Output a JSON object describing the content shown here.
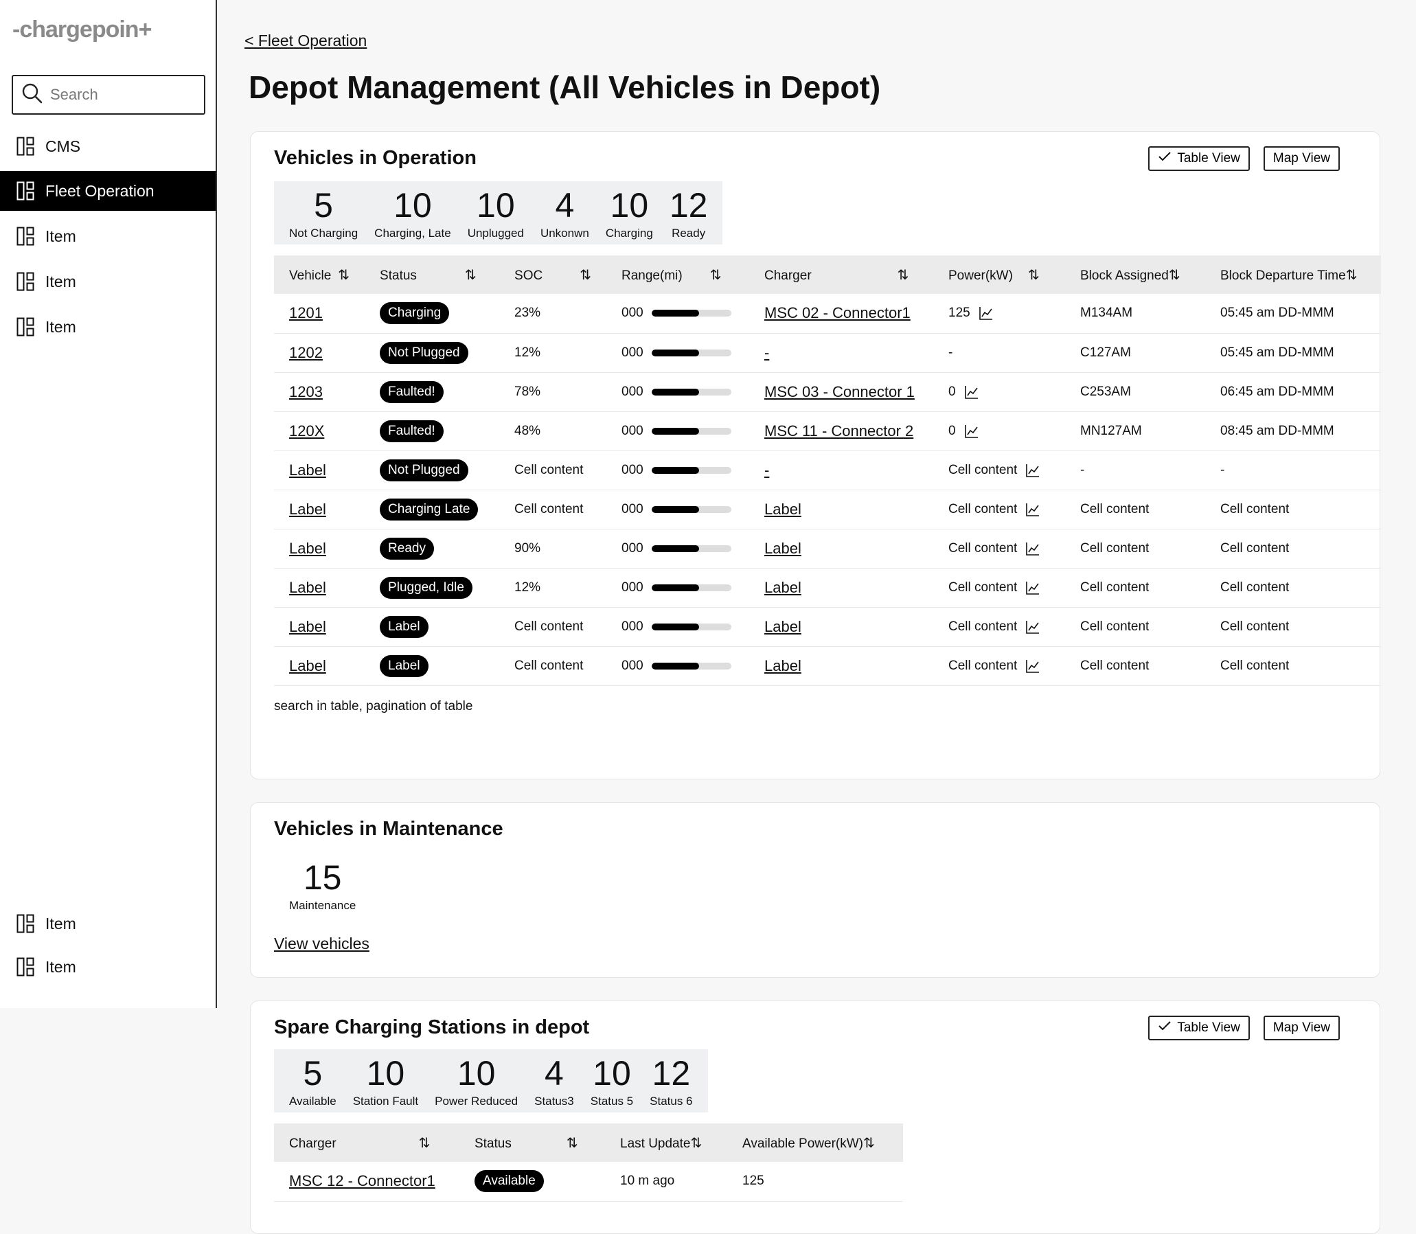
{
  "app": {
    "logo": "-chargepoin+"
  },
  "sidebar": {
    "search_placeholder": "Search",
    "items": [
      {
        "label": "CMS"
      },
      {
        "label": "Fleet Operation"
      },
      {
        "label": "Item"
      },
      {
        "label": "Item"
      },
      {
        "label": "Item"
      }
    ],
    "bottom_items": [
      {
        "label": "Item"
      },
      {
        "label": "Item"
      }
    ]
  },
  "breadcrumb": "< Fleet Operation",
  "page_title": "Depot Management (All Vehicles in Depot)",
  "operation": {
    "title": "Vehicles in Operation",
    "table_view": "Table View",
    "map_view": "Map View",
    "stats": [
      {
        "num": "5",
        "label": "Not Charging"
      },
      {
        "num": "10",
        "label": "Charging, Late"
      },
      {
        "num": "10",
        "label": "Unplugged"
      },
      {
        "num": "4",
        "label": "Unkonwn"
      },
      {
        "num": "10",
        "label": "Charging"
      },
      {
        "num": "12",
        "label": "Ready"
      }
    ],
    "columns": [
      "Vehicle",
      "Status",
      "SOC",
      "Range(mi)",
      "Charger",
      "Power(kW)",
      "Block Assigned",
      "Block Departure Time"
    ],
    "rows": [
      {
        "vehicle": "1201",
        "status": "Charging",
        "soc": "23%",
        "range": "000",
        "range_pct": 0.6,
        "charger": "MSC 02 - Connector1",
        "power": "125",
        "block": "M134AM",
        "departure": "05:45 am DD-MMM"
      },
      {
        "vehicle": "1202",
        "status": "Not Plugged",
        "soc": "12%",
        "range": "000",
        "range_pct": 0.6,
        "charger": "-",
        "power": "-",
        "block": "C127AM",
        "departure": "05:45 am DD-MMM"
      },
      {
        "vehicle": "1203",
        "status": "Faulted!",
        "soc": "78%",
        "range": "000",
        "range_pct": 0.6,
        "charger": "MSC 03 - Connector 1",
        "power": "0",
        "block": "C253AM",
        "departure": "06:45 am DD-MMM"
      },
      {
        "vehicle": "120X",
        "status": "Faulted!",
        "soc": "48%",
        "range": "000",
        "range_pct": 0.6,
        "charger": "MSC 11 - Connector 2",
        "power": "0",
        "block": "MN127AM",
        "departure": "08:45 am DD-MMM"
      },
      {
        "vehicle": "Label",
        "status": "Not Plugged",
        "soc": "Cell content",
        "range": "000",
        "range_pct": 0.6,
        "charger": "-",
        "power": "Cell content",
        "block": "-",
        "departure": "-"
      },
      {
        "vehicle": "Label",
        "status": "Charging Late",
        "soc": "Cell content",
        "range": "000",
        "range_pct": 0.6,
        "charger": "Label",
        "power": "Cell content",
        "block": "Cell content",
        "departure": "Cell content"
      },
      {
        "vehicle": "Label",
        "status": "Ready",
        "soc": "90%",
        "range": "000",
        "range_pct": 0.6,
        "charger": "Label",
        "power": "Cell content",
        "block": "Cell content",
        "departure": "Cell content"
      },
      {
        "vehicle": "Label",
        "status": "Plugged, Idle",
        "soc": "12%",
        "range": "000",
        "range_pct": 0.6,
        "charger": "Label",
        "power": "Cell content",
        "block": "Cell content",
        "departure": "Cell content"
      },
      {
        "vehicle": "Label",
        "status": "Label",
        "soc": "Cell content",
        "range": "000",
        "range_pct": 0.6,
        "charger": "Label",
        "power": "Cell content",
        "block": "Cell content",
        "departure": "Cell content"
      },
      {
        "vehicle": "Label",
        "status": "Label",
        "soc": "Cell content",
        "range": "000",
        "range_pct": 0.6,
        "charger": "Label",
        "power": "Cell content",
        "block": "Cell content",
        "departure": "Cell content"
      }
    ],
    "note": "search in table, pagination of table"
  },
  "maintenance": {
    "title": "Vehicles in Maintenance",
    "stats": [
      {
        "num": "15",
        "label": "Maintenance"
      }
    ],
    "view_link": "View vehicles"
  },
  "spare": {
    "title": "Spare Charging Stations in depot",
    "table_view": "Table View",
    "map_view": "Map View",
    "stats": [
      {
        "num": "5",
        "label": "Available"
      },
      {
        "num": "10",
        "label": "Station Fault"
      },
      {
        "num": "10",
        "label": "Power Reduced"
      },
      {
        "num": "4",
        "label": "Status3"
      },
      {
        "num": "10",
        "label": "Status 5"
      },
      {
        "num": "12",
        "label": "Status 6"
      }
    ],
    "columns": [
      "Charger",
      "Status",
      "Last Update",
      "Available Power(kW)"
    ],
    "rows": [
      {
        "charger": "MSC 12 - Connector1",
        "status": "Available",
        "updated": "10 m ago",
        "power": "125"
      }
    ]
  }
}
